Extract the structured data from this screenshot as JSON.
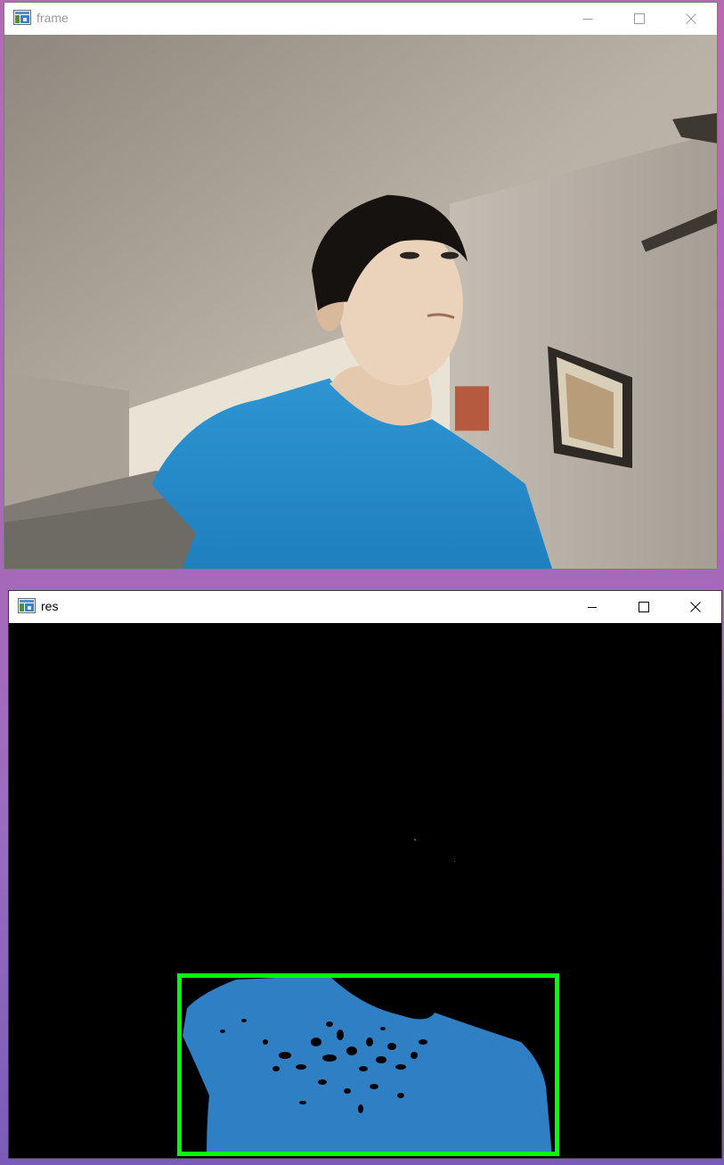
{
  "windows": [
    {
      "title": "frame",
      "icon": "opencv-window-icon",
      "controls": [
        "minimize-icon",
        "maximize-icon",
        "close-icon"
      ],
      "content": "webcam-feed"
    },
    {
      "title": "res",
      "icon": "opencv-window-icon",
      "controls": [
        "minimize-icon",
        "maximize-icon",
        "close-icon"
      ],
      "content": "color-mask-result",
      "box_color": "#00ff00",
      "mask_color": "#2f7fc4"
    }
  ]
}
